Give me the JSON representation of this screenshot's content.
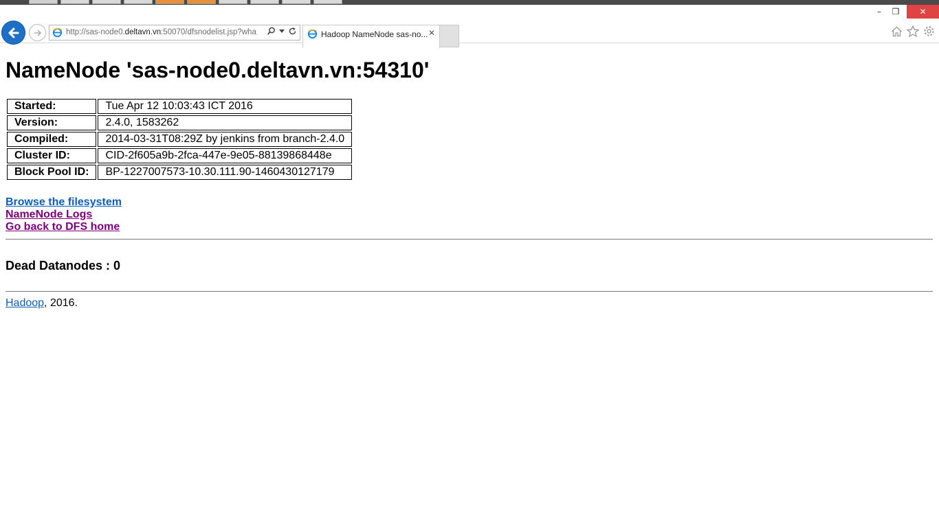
{
  "browser": {
    "url_prefix": "http://sas-node0.",
    "url_host": "deltavn.vn",
    "url_suffix": ":50070/dfsnodelist.jsp?wha",
    "tab_title": "Hadoop NameNode sas-no...",
    "window_controls": {
      "minimize": "–",
      "restore": "❐",
      "close": "✕"
    }
  },
  "page": {
    "title": "NameNode 'sas-node0.deltavn.vn:54310'",
    "info": [
      {
        "label": "Started:",
        "value": "Tue Apr 12 10:03:43 ICT 2016"
      },
      {
        "label": "Version:",
        "value": "2.4.0, 1583262"
      },
      {
        "label": "Compiled:",
        "value": "2014-03-31T08:29Z by jenkins from branch-2.4.0"
      },
      {
        "label": "Cluster ID:",
        "value": "CID-2f605a9b-2fca-447e-9e05-88139868448e"
      },
      {
        "label": "Block Pool ID:",
        "value": "BP-1227007573-10.30.111.90-1460430127179"
      }
    ],
    "links": {
      "browse": "Browse the filesystem",
      "logs": "NameNode Logs",
      "home": "Go back to DFS home"
    },
    "dead_heading": "Dead Datanodes : 0",
    "footer": {
      "link": "Hadoop",
      "text": ", 2016."
    }
  }
}
